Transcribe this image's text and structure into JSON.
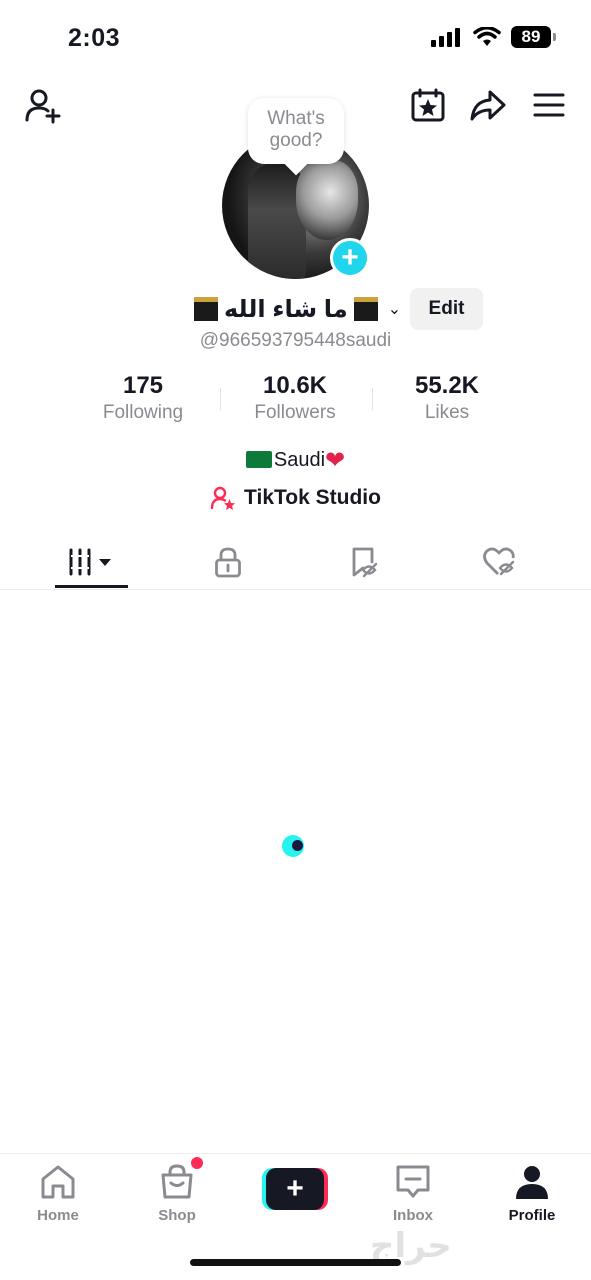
{
  "status_bar": {
    "time": "2:03",
    "battery": "89"
  },
  "bubble": {
    "text": "What's good?"
  },
  "profile": {
    "display_name": "ما شاء الله",
    "username": "@966593795448saudi",
    "edit_label": "Edit"
  },
  "stats": [
    {
      "value": "175",
      "label": "Following"
    },
    {
      "value": "10.6K",
      "label": "Followers"
    },
    {
      "value": "55.2K",
      "label": "Likes"
    }
  ],
  "bio": {
    "text": "Saudi"
  },
  "studio": {
    "label": "TikTok Studio"
  },
  "tabs": [
    {
      "icon": "grid-icon"
    },
    {
      "icon": "lock-icon"
    },
    {
      "icon": "bookmark-icon"
    },
    {
      "icon": "heart-hidden-icon"
    }
  ],
  "nav": {
    "home": "Home",
    "shop": "Shop",
    "inbox": "Inbox",
    "profile": "Profile"
  },
  "watermark": "حراج",
  "colors": {
    "accent_cyan": "#25f4ee",
    "accent_red": "#fe2c55",
    "add_avatar": "#20d5ec",
    "text_dark": "#161823",
    "text_gray": "#8a8b91"
  }
}
